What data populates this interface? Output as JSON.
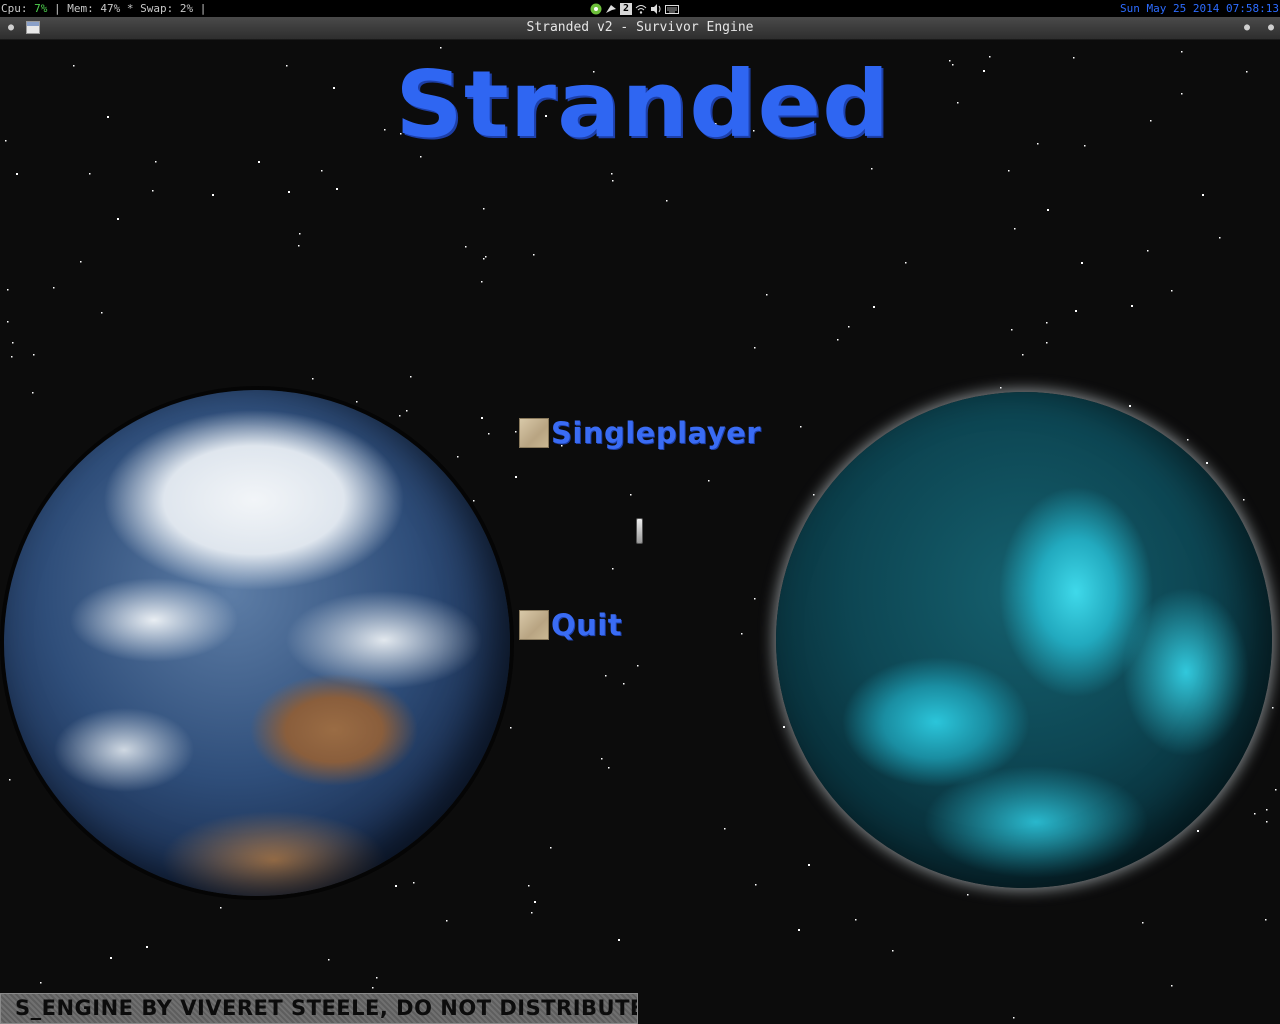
{
  "statusbar": {
    "cpu_label": "Cpu: ",
    "cpu_value": "7%",
    "mem_text": " | Mem: 47% * Swap: 2% |",
    "workspace": "2",
    "clock": "Sun May 25 2014 07:58:13",
    "tray_icons": [
      "steam-icon",
      "pidgin-icon",
      "workspace-icon",
      "wifi-icon",
      "volume-icon",
      "keyboard-icon"
    ]
  },
  "window": {
    "title": "Stranded v2 - Survivor Engine"
  },
  "game": {
    "title": "Stranded",
    "menu": [
      {
        "label": "Singleplayer"
      },
      {
        "label": "Quit"
      }
    ],
    "credit": "S_ENGINE BY VIVERET STEELE, DO NOT DISTRIBUTE"
  },
  "colors": {
    "accent": "#3a6cf4",
    "background": "#0c0c0c",
    "clock": "#2d6cff"
  }
}
